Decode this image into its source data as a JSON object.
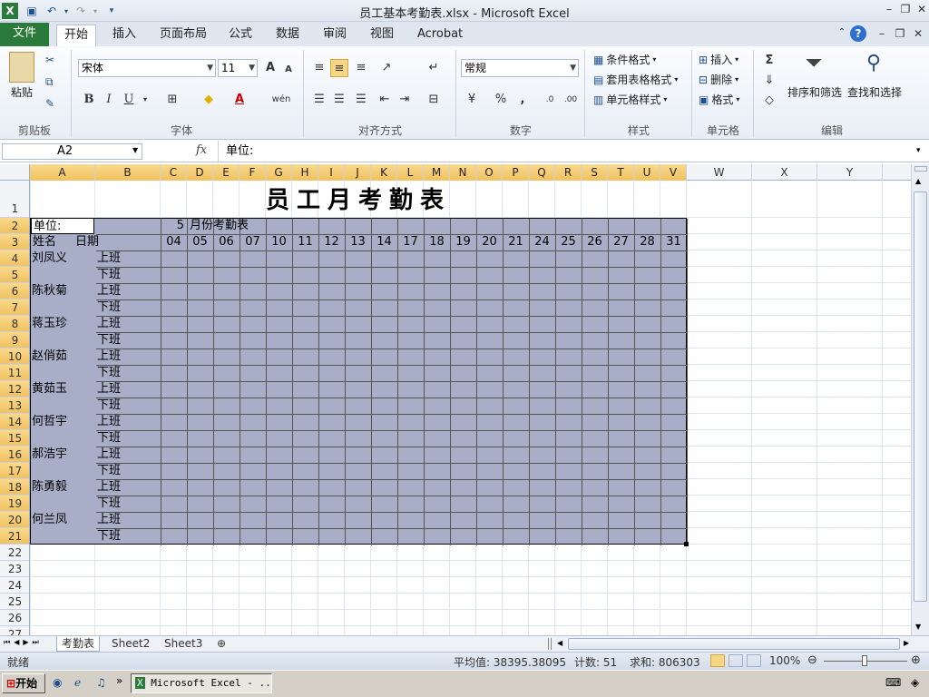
{
  "window": {
    "title": "员工基本考勤表.xlsx - Microsoft Excel",
    "qat_icons": [
      "excel-icon",
      "save-icon",
      "undo-icon",
      "redo-icon",
      "customize-icon"
    ]
  },
  "tabs": {
    "file": "文件",
    "items": [
      "开始",
      "插入",
      "页面布局",
      "公式",
      "数据",
      "审阅",
      "视图",
      "Acrobat"
    ],
    "active": "开始"
  },
  "ribbon": {
    "clipboard": {
      "label": "剪贴板",
      "paste": "粘贴"
    },
    "font": {
      "label": "字体",
      "name": "宋体",
      "size": "11",
      "bold": "B",
      "italic": "I",
      "underline": "U",
      "grow": "A",
      "shrink": "A",
      "phonetic": "wén"
    },
    "alignment": {
      "label": "对齐方式"
    },
    "number": {
      "label": "数字",
      "format": "常规",
      "percent": "%",
      "comma": ",",
      "inc": ".0",
      "dec": ".00"
    },
    "styles": {
      "label": "样式",
      "conditional": "条件格式",
      "table": "套用表格格式",
      "cell": "单元格样式"
    },
    "cells": {
      "label": "单元格",
      "insert": "插入",
      "delete": "删除",
      "format": "格式"
    },
    "editing": {
      "label": "编辑",
      "sigma": "Σ",
      "sort": "排序和筛选",
      "find": "查找和选择"
    }
  },
  "formula_bar": {
    "name_box": "A2",
    "fx": "fx",
    "content": "单位:"
  },
  "columns": [
    "A",
    "B",
    "C",
    "D",
    "E",
    "F",
    "G",
    "H",
    "I",
    "J",
    "K",
    "L",
    "M",
    "N",
    "O",
    "P",
    "Q",
    "R",
    "S",
    "T",
    "U",
    "V",
    "W",
    "X",
    "Y"
  ],
  "rows": [
    "1",
    "2",
    "3",
    "4",
    "5",
    "6",
    "7",
    "8",
    "9",
    "10",
    "11",
    "12",
    "13",
    "14",
    "15",
    "16",
    "17",
    "18",
    "19",
    "20",
    "21",
    "22",
    "23",
    "24",
    "25",
    "26",
    "27"
  ],
  "sheet": {
    "title": "员工月考勤表",
    "unit_label": "单位:",
    "month_number": "5",
    "month_title": "月份考勤表",
    "name_header": "姓名",
    "date_header": "日期",
    "dates": [
      "04",
      "05",
      "06",
      "07",
      "10",
      "11",
      "12",
      "13",
      "14",
      "17",
      "18",
      "19",
      "20",
      "21",
      "24",
      "25",
      "26",
      "27",
      "28",
      "31"
    ],
    "shift_in": "上班",
    "shift_out": "下班",
    "employees": [
      "刘凤义",
      "陈秋菊",
      "蒋玉珍",
      "赵俏茹",
      "黄茹玉",
      "何哲宇",
      "郝浩宇",
      "陈勇毅",
      "何兰凤"
    ]
  },
  "sheet_tabs": [
    "考勤表",
    "Sheet2",
    "Sheet3"
  ],
  "status": {
    "ready": "就绪",
    "average": "平均值: 38395.38095",
    "count": "计数: 51",
    "sum": "求和: 806303",
    "zoom": "100%"
  },
  "taskbar": {
    "start": "开始",
    "window": "Microsoft Excel - ..."
  }
}
